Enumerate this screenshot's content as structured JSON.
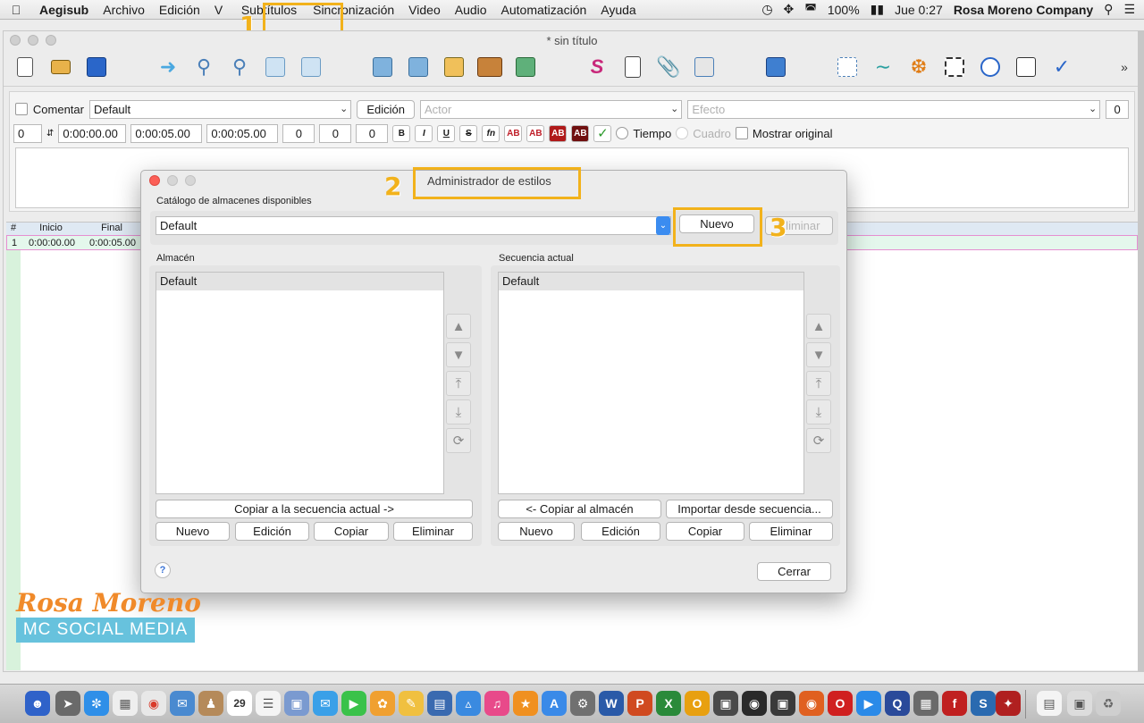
{
  "menubar": {
    "app": "Aegisub",
    "items": [
      "Archivo",
      "Edición",
      "V",
      "Subtítulos",
      "Sincronización",
      "Video",
      "Audio",
      "Automatización",
      "Ayuda"
    ],
    "battery": "100%",
    "clock": "Jue 0:27",
    "user": "Rosa Moreno Company"
  },
  "window": {
    "title": "* sin título"
  },
  "editbox": {
    "comment_label": "Comentar",
    "style_value": "Default",
    "edit_button": "Edición",
    "actor_placeholder": "Actor",
    "effect_placeholder": "Efecto",
    "margin_value": "0",
    "layer": "0",
    "start": "0:00:00.00",
    "end": "0:00:05.00",
    "duration": "0:00:05.00",
    "margin_l": "0",
    "margin_r": "0",
    "margin_v": "0",
    "fmt_bold": "B",
    "fmt_italic": "I",
    "fmt_underline": "U",
    "fmt_strike": "S",
    "fmt_fn": "fn",
    "fmt_ab": "AB",
    "time_label": "Tiempo",
    "frame_label": "Cuadro",
    "show_original_label": "Mostrar original"
  },
  "grid": {
    "headers": [
      "#",
      "Inicio",
      "Final"
    ],
    "row": {
      "num": "1",
      "start": "0:00:00.00",
      "end": "0:00:05.00"
    }
  },
  "dialog": {
    "title": "Administrador de estilos",
    "catalog_label": "Catálogo de almacenes disponibles",
    "catalog_value": "Default",
    "new_catalog_button": "Nuevo",
    "delete_catalog_button": "Eliminar",
    "storage_label": "Almacén",
    "storage_item": "Default",
    "current_label": "Secuencia actual",
    "current_item": "Default",
    "copy_to_current": "Copiar a la secuencia actual ->",
    "copy_to_storage": "<- Copiar al almacén",
    "import_from_script": "Importar desde secuencia...",
    "new": "Nuevo",
    "edit": "Edición",
    "copy": "Copiar",
    "delete": "Eliminar",
    "help": "?",
    "close": "Cerrar"
  },
  "annotations": {
    "n1": "1",
    "n2": "2",
    "n3": "3"
  },
  "watermark": {
    "script": "Rosa Moreno",
    "banner": "MC SOCIAL MEDIA"
  },
  "colors": {
    "highlight": "#f2b21b",
    "accent_blue": "#3b8cf0",
    "watermark_orange": "#f08a2a",
    "watermark_blue": "#67c2dd"
  }
}
